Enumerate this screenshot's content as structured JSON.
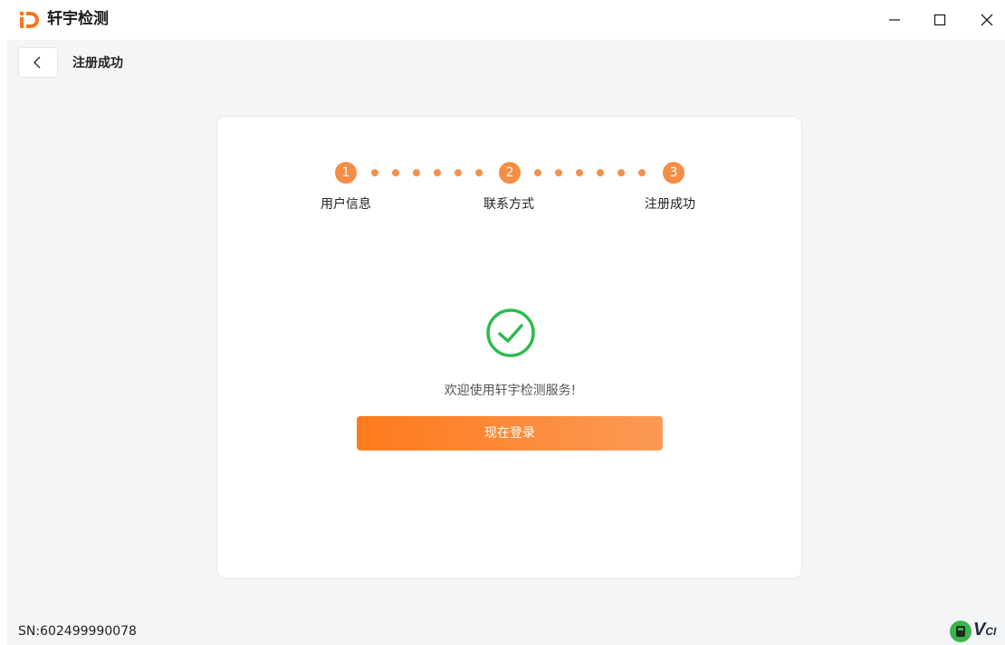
{
  "app": {
    "logo_text": "iD",
    "title": "轩宇检测"
  },
  "window_controls": {
    "minimize_icon": "minimize-icon",
    "maximize_icon": "maximize-icon",
    "close_icon": "close-icon"
  },
  "header": {
    "back_icon": "chevron-left-icon",
    "breadcrumb": "注册成功"
  },
  "steps": [
    {
      "number": "1",
      "label": "用户信息"
    },
    {
      "number": "2",
      "label": "联系方式"
    },
    {
      "number": "3",
      "label": "注册成功"
    }
  ],
  "result": {
    "icon": "check-circle-icon",
    "message": "欢迎使用轩宇检测服务!",
    "login_button": "现在登录"
  },
  "footer": {
    "serial": "SN:602499990078",
    "brand_text": "V",
    "brand_sub": "CI"
  },
  "colors": {
    "accent": "#f58d45",
    "success": "#2dbb4e",
    "button_start": "#ff7a1c",
    "button_end": "#fb9a55"
  }
}
